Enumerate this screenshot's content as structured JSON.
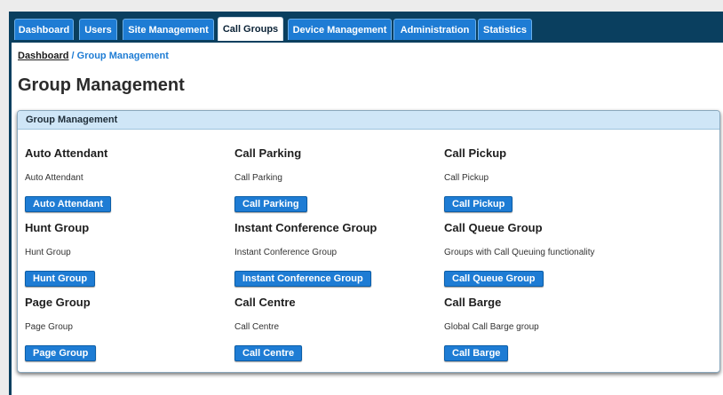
{
  "nav": {
    "tabs": [
      {
        "label": "Dashboard",
        "active": false
      },
      {
        "label": "Users",
        "active": false
      },
      {
        "label": "Site Management",
        "active": false
      },
      {
        "label": "Call Groups",
        "active": true
      },
      {
        "label": "Device Management",
        "active": false
      },
      {
        "label": "Administration",
        "active": false
      },
      {
        "label": "Statistics",
        "active": false
      }
    ]
  },
  "breadcrumb": {
    "root": "Dashboard",
    "separator": " / ",
    "current": "Group Management"
  },
  "page": {
    "title": "Group Management"
  },
  "panel": {
    "header": "Group Management",
    "groups": [
      {
        "title": "Auto Attendant",
        "description": "Auto Attendant",
        "button": "Auto Attendant"
      },
      {
        "title": "Call Parking",
        "description": "Call Parking",
        "button": "Call Parking"
      },
      {
        "title": "Call Pickup",
        "description": "Call Pickup",
        "button": "Call Pickup"
      },
      {
        "title": "Hunt Group",
        "description": "Hunt Group",
        "button": "Hunt Group"
      },
      {
        "title": "Instant Conference Group",
        "description": "Instant Conference Group",
        "button": "Instant Conference Group"
      },
      {
        "title": "Call Queue Group",
        "description": "Groups with Call Queuing functionality",
        "button": "Call Queue Group"
      },
      {
        "title": "Page Group",
        "description": "Page Group",
        "button": "Page Group"
      },
      {
        "title": "Call Centre",
        "description": "Call Centre",
        "button": "Call Centre"
      },
      {
        "title": "Call Barge",
        "description": "Global Call Barge group",
        "button": "Call Barge"
      }
    ]
  },
  "colors": {
    "navbar": "#0a3f5f",
    "tab": "#1e7cd4",
    "button": "#1e7cd4",
    "panel_header": "#cfe6f7",
    "link": "#1e7cd4"
  }
}
